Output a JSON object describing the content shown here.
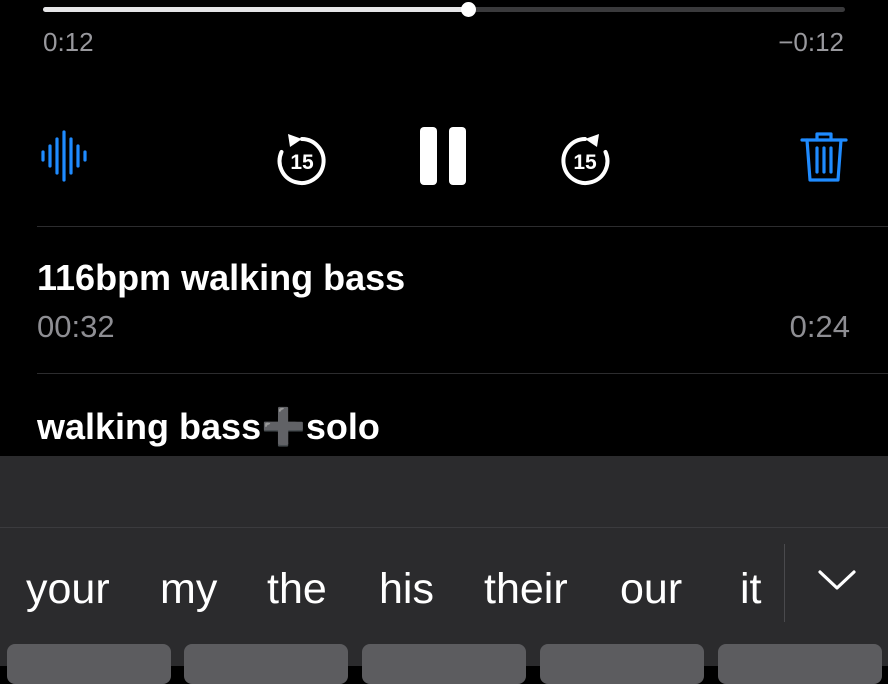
{
  "player": {
    "progress": 0.53,
    "elapsed": "0:12",
    "remaining": "−0:12",
    "controls": {
      "waveform_icon": "waveform-icon",
      "skip_back_label": "15",
      "pause_icon": "pause-icon",
      "skip_forward_label": "15",
      "delete_icon": "trash-icon"
    }
  },
  "recordings": [
    {
      "title": "116bpm walking bass",
      "date": "00:32",
      "duration": "0:24"
    },
    {
      "title": "walking bass➕solo"
    }
  ],
  "keyboard": {
    "suggestions": [
      "your",
      "my",
      "the",
      "his",
      "their",
      "our",
      "it"
    ],
    "dismiss_icon": "chevron-down-icon"
  },
  "colors": {
    "accent": "#1f8bff",
    "background": "#000000",
    "keyboard": "#2b2b2d"
  }
}
